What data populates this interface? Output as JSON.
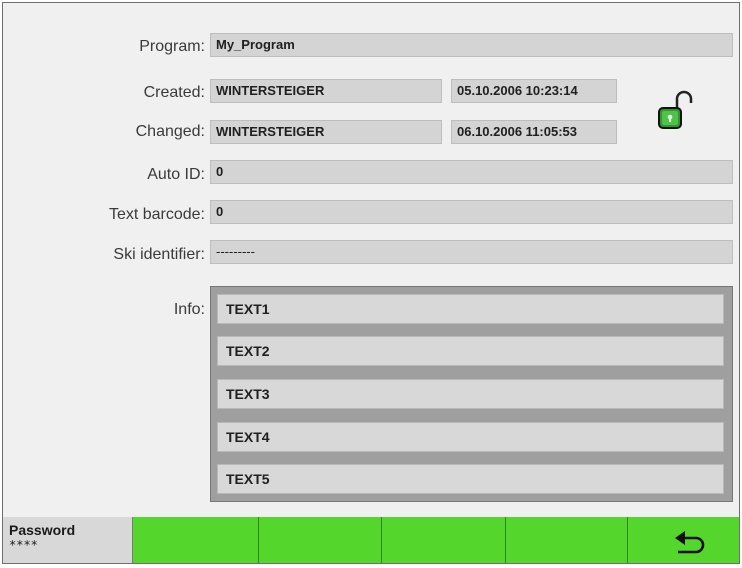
{
  "form": {
    "program": {
      "label": "Program:",
      "value": "My_Program"
    },
    "created": {
      "label": "Created:",
      "user": "WINTERSTEIGER",
      "timestamp": "05.10.2006 10:23:14"
    },
    "changed": {
      "label": "Changed:",
      "user": "WINTERSTEIGER",
      "timestamp": "06.10.2006 11:05:53"
    },
    "auto_id": {
      "label": "Auto ID:",
      "value": "0"
    },
    "text_barcode": {
      "label": "Text barcode:",
      "value": "0"
    },
    "ski_identifier": {
      "label": "Ski identifier:",
      "value": "---------"
    },
    "info": {
      "label": "Info:",
      "rows": [
        "TEXT1",
        "TEXT2",
        "TEXT3",
        "TEXT4",
        "TEXT5"
      ]
    }
  },
  "lock": {
    "icon": "unlocked-padlock-icon",
    "color": "#2f9a2a"
  },
  "bottom_bar": {
    "password": {
      "title": "Password",
      "value": "****"
    },
    "back_icon": "back-arrow-icon",
    "accent": "#55d62d"
  }
}
